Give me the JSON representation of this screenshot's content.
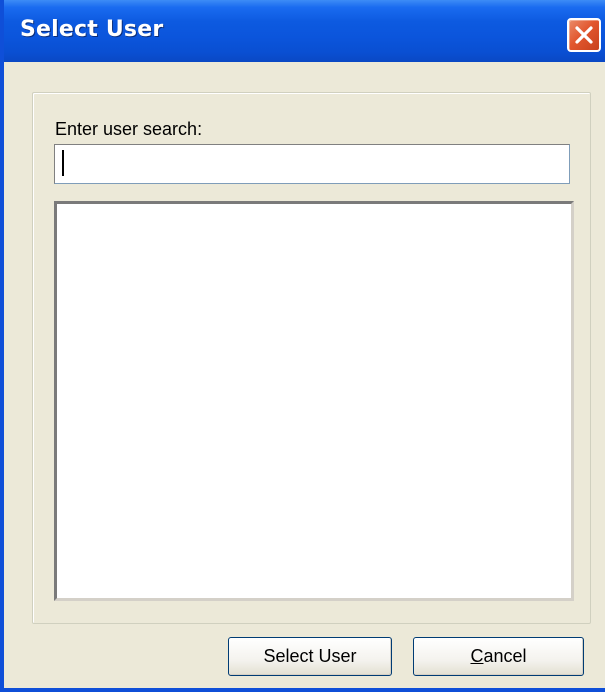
{
  "window": {
    "title": "Select User",
    "close_icon": "close-icon"
  },
  "search": {
    "label": "Enter user search:",
    "value": "",
    "placeholder": ""
  },
  "user_list": {
    "items": []
  },
  "buttons": {
    "select_label": "Select User",
    "cancel_mnemonic": "C",
    "cancel_rest": "ancel"
  },
  "colors": {
    "titlebar": "#0a55dc",
    "close_button": "#e2572f",
    "dialog_face": "#ece9d8"
  }
}
